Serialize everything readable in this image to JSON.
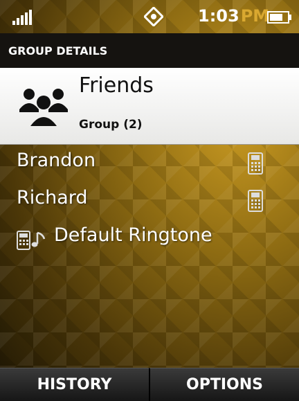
{
  "status_bar": {
    "time": "1:03",
    "ampm": "PM",
    "signal_icon": "signal-bars-icon",
    "gps_icon": "gps-icon",
    "battery_icon": "battery-icon"
  },
  "header": {
    "title": "GROUP DETAILS"
  },
  "group": {
    "name": "Friends",
    "subtitle": "Group (2)",
    "icon": "group-people-icon"
  },
  "members": [
    {
      "name": "Brandon",
      "icon": "mobile-phone-icon"
    },
    {
      "name": "Richard",
      "icon": "mobile-phone-icon"
    }
  ],
  "ringtone": {
    "label": "Default Ringtone",
    "icon": "ringtone-icon"
  },
  "softkeys": {
    "left": "HISTORY",
    "right": "OPTIONS"
  },
  "colors": {
    "accent": "#d9a830",
    "title_bar": "#151310",
    "card": "#ffffff"
  }
}
